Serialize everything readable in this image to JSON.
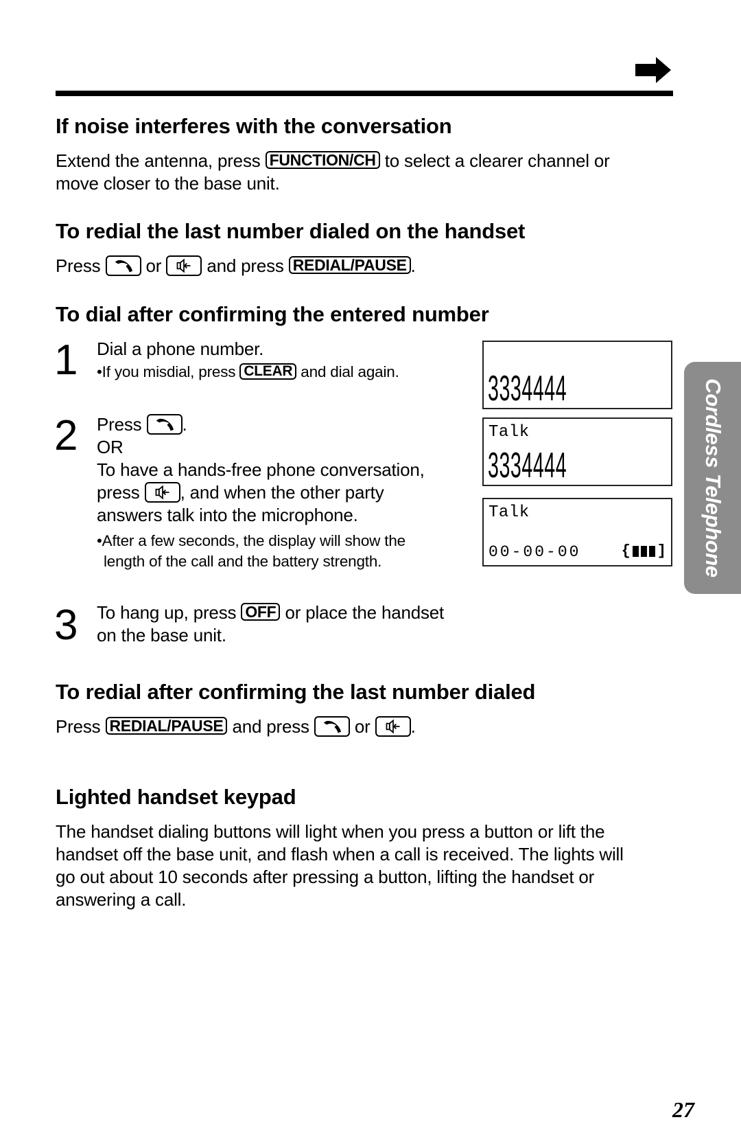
{
  "page": {
    "number": "27",
    "side_tab": "Cordless Telephone",
    "continue_indicator": "right-arrow-icon"
  },
  "sections": {
    "noise": {
      "heading": "If noise interferes with the conversation",
      "line1_pre": "Extend the antenna, press",
      "key": "FUNCTION/CH",
      "line1_post": "to select a clearer channel or",
      "line2": "move closer to the base unit."
    },
    "redial_last": {
      "heading": "To redial the last number dialed on the handset",
      "press": "Press",
      "icon1": "talk-key-icon",
      "or": "or",
      "icon2": "speakerphone-key-icon",
      "and_press": "and press",
      "key": "REDIAL/PAUSE",
      "end": "."
    },
    "dial_confirm": {
      "heading": "To dial after confirming the entered number",
      "steps": [
        {
          "number": "1",
          "text": "Dial a phone number.",
          "note_pre": "•If you misdial, press",
          "note_key": "CLEAR",
          "note_post": "and dial again."
        },
        {
          "number": "2",
          "press": "Press",
          "press_end": ".",
          "or": "OR",
          "line1": "To have a hands-free phone conversation,",
          "line2_pre": "press",
          "line2_post": ", and when the other party",
          "line3": "answers talk into the microphone.",
          "note_line1": "•After a few seconds, the display will show the",
          "note_line2": "length of the call and the battery strength."
        },
        {
          "number": "3",
          "line1_pre": "To hang up, press",
          "key": "OFF",
          "line1_post": "or place the handset",
          "line2": "on the base unit."
        }
      ],
      "displays": [
        {
          "label": "",
          "digits": "3334444"
        },
        {
          "label": "Talk",
          "digits": "3334444"
        },
        {
          "label": "Talk",
          "timer": "00-00-00",
          "battery_open": "{",
          "battery_close": "]",
          "battery_level": "3/3"
        }
      ]
    },
    "redial_confirm": {
      "heading": "To redial after confirming the last number dialed",
      "press": "Press",
      "key": "REDIAL/PAUSE",
      "and_press": "and press",
      "or": "or",
      "end": "."
    },
    "keypad": {
      "heading": "Lighted handset keypad",
      "lines": [
        "The handset dialing buttons will light when you press a button or lift the",
        "handset off the base unit, and flash when a call is received. The lights will",
        "go out about 10 seconds after pressing a button, lifting the handset or",
        "answering a call."
      ]
    }
  }
}
